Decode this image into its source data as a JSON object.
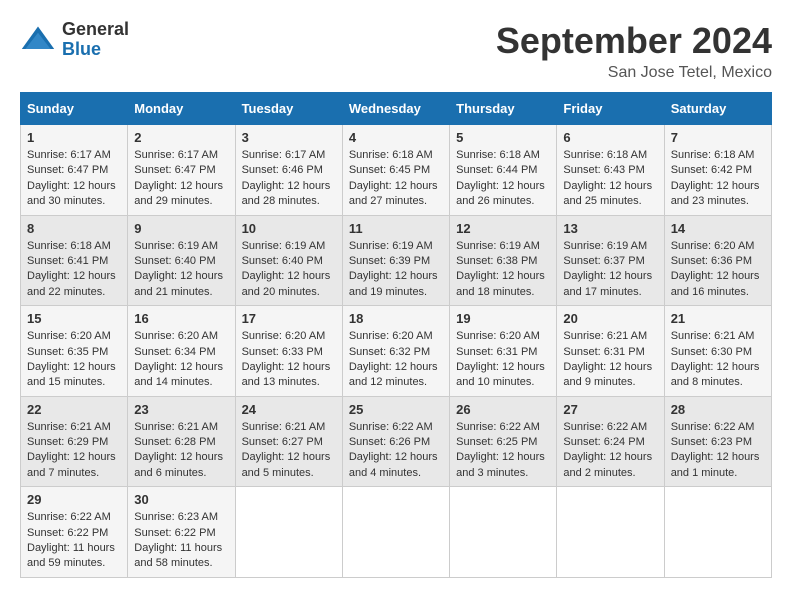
{
  "header": {
    "logo": {
      "general": "General",
      "blue": "Blue"
    },
    "title": "September 2024",
    "location": "San Jose Tetel, Mexico"
  },
  "weekdays": [
    "Sunday",
    "Monday",
    "Tuesday",
    "Wednesday",
    "Thursday",
    "Friday",
    "Saturday"
  ],
  "weeks": [
    [
      {
        "day": "1",
        "sunrise": "6:17 AM",
        "sunset": "6:47 PM",
        "daylight": "12 hours and 30 minutes."
      },
      {
        "day": "2",
        "sunrise": "6:17 AM",
        "sunset": "6:47 PM",
        "daylight": "12 hours and 29 minutes."
      },
      {
        "day": "3",
        "sunrise": "6:17 AM",
        "sunset": "6:46 PM",
        "daylight": "12 hours and 28 minutes."
      },
      {
        "day": "4",
        "sunrise": "6:18 AM",
        "sunset": "6:45 PM",
        "daylight": "12 hours and 27 minutes."
      },
      {
        "day": "5",
        "sunrise": "6:18 AM",
        "sunset": "6:44 PM",
        "daylight": "12 hours and 26 minutes."
      },
      {
        "day": "6",
        "sunrise": "6:18 AM",
        "sunset": "6:43 PM",
        "daylight": "12 hours and 25 minutes."
      },
      {
        "day": "7",
        "sunrise": "6:18 AM",
        "sunset": "6:42 PM",
        "daylight": "12 hours and 23 minutes."
      }
    ],
    [
      {
        "day": "8",
        "sunrise": "6:18 AM",
        "sunset": "6:41 PM",
        "daylight": "12 hours and 22 minutes."
      },
      {
        "day": "9",
        "sunrise": "6:19 AM",
        "sunset": "6:40 PM",
        "daylight": "12 hours and 21 minutes."
      },
      {
        "day": "10",
        "sunrise": "6:19 AM",
        "sunset": "6:40 PM",
        "daylight": "12 hours and 20 minutes."
      },
      {
        "day": "11",
        "sunrise": "6:19 AM",
        "sunset": "6:39 PM",
        "daylight": "12 hours and 19 minutes."
      },
      {
        "day": "12",
        "sunrise": "6:19 AM",
        "sunset": "6:38 PM",
        "daylight": "12 hours and 18 minutes."
      },
      {
        "day": "13",
        "sunrise": "6:19 AM",
        "sunset": "6:37 PM",
        "daylight": "12 hours and 17 minutes."
      },
      {
        "day": "14",
        "sunrise": "6:20 AM",
        "sunset": "6:36 PM",
        "daylight": "12 hours and 16 minutes."
      }
    ],
    [
      {
        "day": "15",
        "sunrise": "6:20 AM",
        "sunset": "6:35 PM",
        "daylight": "12 hours and 15 minutes."
      },
      {
        "day": "16",
        "sunrise": "6:20 AM",
        "sunset": "6:34 PM",
        "daylight": "12 hours and 14 minutes."
      },
      {
        "day": "17",
        "sunrise": "6:20 AM",
        "sunset": "6:33 PM",
        "daylight": "12 hours and 13 minutes."
      },
      {
        "day": "18",
        "sunrise": "6:20 AM",
        "sunset": "6:32 PM",
        "daylight": "12 hours and 12 minutes."
      },
      {
        "day": "19",
        "sunrise": "6:20 AM",
        "sunset": "6:31 PM",
        "daylight": "12 hours and 10 minutes."
      },
      {
        "day": "20",
        "sunrise": "6:21 AM",
        "sunset": "6:31 PM",
        "daylight": "12 hours and 9 minutes."
      },
      {
        "day": "21",
        "sunrise": "6:21 AM",
        "sunset": "6:30 PM",
        "daylight": "12 hours and 8 minutes."
      }
    ],
    [
      {
        "day": "22",
        "sunrise": "6:21 AM",
        "sunset": "6:29 PM",
        "daylight": "12 hours and 7 minutes."
      },
      {
        "day": "23",
        "sunrise": "6:21 AM",
        "sunset": "6:28 PM",
        "daylight": "12 hours and 6 minutes."
      },
      {
        "day": "24",
        "sunrise": "6:21 AM",
        "sunset": "6:27 PM",
        "daylight": "12 hours and 5 minutes."
      },
      {
        "day": "25",
        "sunrise": "6:22 AM",
        "sunset": "6:26 PM",
        "daylight": "12 hours and 4 minutes."
      },
      {
        "day": "26",
        "sunrise": "6:22 AM",
        "sunset": "6:25 PM",
        "daylight": "12 hours and 3 minutes."
      },
      {
        "day": "27",
        "sunrise": "6:22 AM",
        "sunset": "6:24 PM",
        "daylight": "12 hours and 2 minutes."
      },
      {
        "day": "28",
        "sunrise": "6:22 AM",
        "sunset": "6:23 PM",
        "daylight": "12 hours and 1 minute."
      }
    ],
    [
      {
        "day": "29",
        "sunrise": "6:22 AM",
        "sunset": "6:22 PM",
        "daylight": "11 hours and 59 minutes."
      },
      {
        "day": "30",
        "sunrise": "6:23 AM",
        "sunset": "6:22 PM",
        "daylight": "11 hours and 58 minutes."
      },
      null,
      null,
      null,
      null,
      null
    ]
  ],
  "labels": {
    "sunrise": "Sunrise:",
    "sunset": "Sunset:",
    "daylight": "Daylight:"
  }
}
